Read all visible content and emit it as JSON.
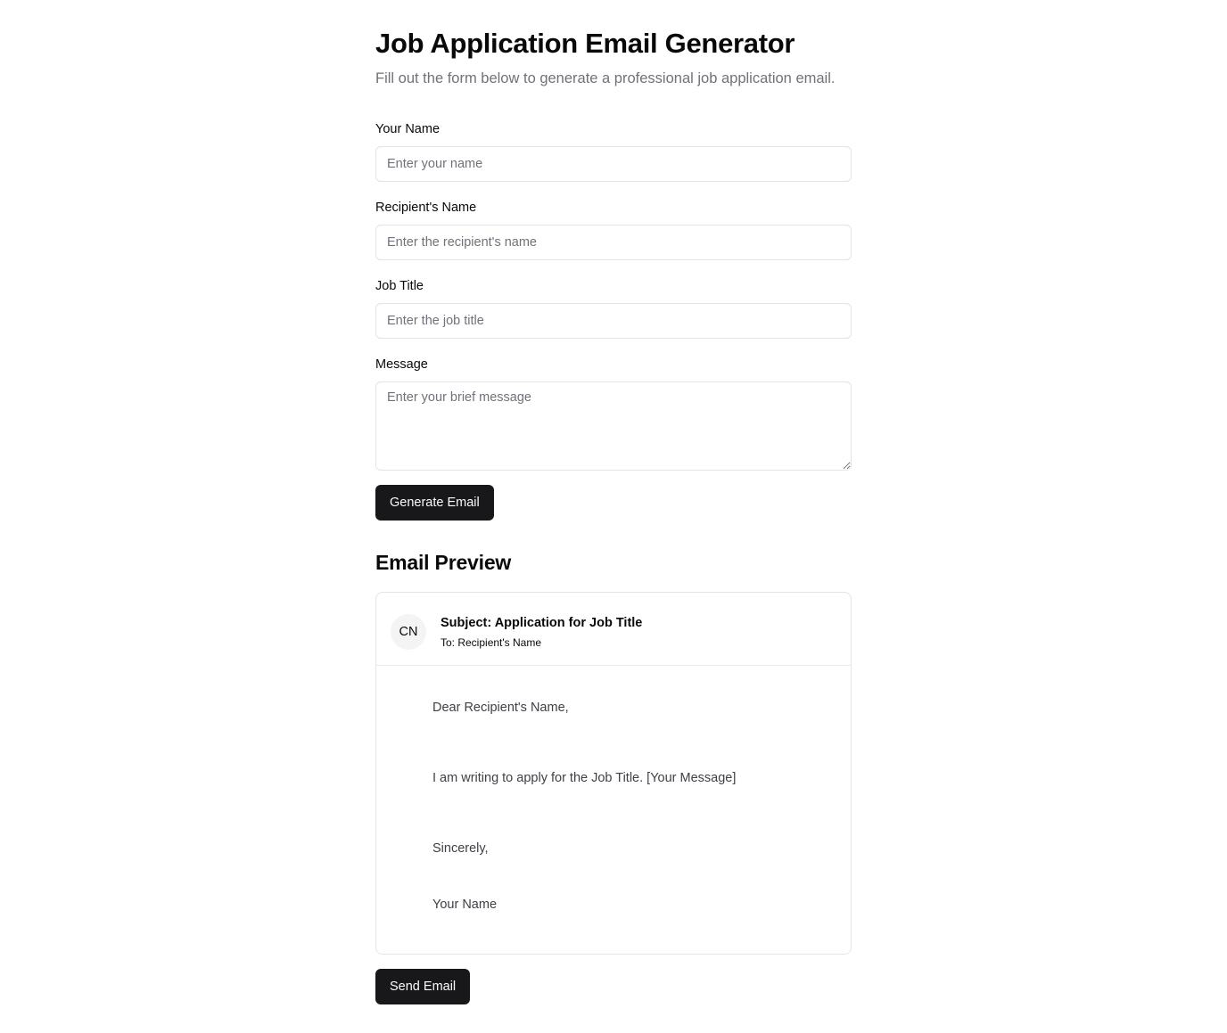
{
  "header": {
    "title": "Job Application Email Generator",
    "subtitle": "Fill out the form below to generate a professional job application email."
  },
  "form": {
    "your_name": {
      "label": "Your Name",
      "placeholder": "Enter your name",
      "value": ""
    },
    "recipient_name": {
      "label": "Recipient's Name",
      "placeholder": "Enter the recipient's name",
      "value": ""
    },
    "job_title": {
      "label": "Job Title",
      "placeholder": "Enter the job title",
      "value": ""
    },
    "message": {
      "label": "Message",
      "placeholder": "Enter your brief message",
      "value": ""
    },
    "generate_button_label": "Generate Email"
  },
  "preview": {
    "section_title": "Email Preview",
    "avatar_initials": "CN",
    "subject": "Subject: Application for Job Title",
    "to": "To: Recipient's Name",
    "greeting": "Dear Recipient's Name,",
    "body": "I am writing to apply for the Job Title. [Your Message]",
    "closing": "Sincerely,",
    "signature": "Your Name",
    "send_button_label": "Send Email"
  },
  "colors": {
    "primary_button": "#18181b",
    "border": "#e4e4e7",
    "muted_text": "#71717a"
  }
}
